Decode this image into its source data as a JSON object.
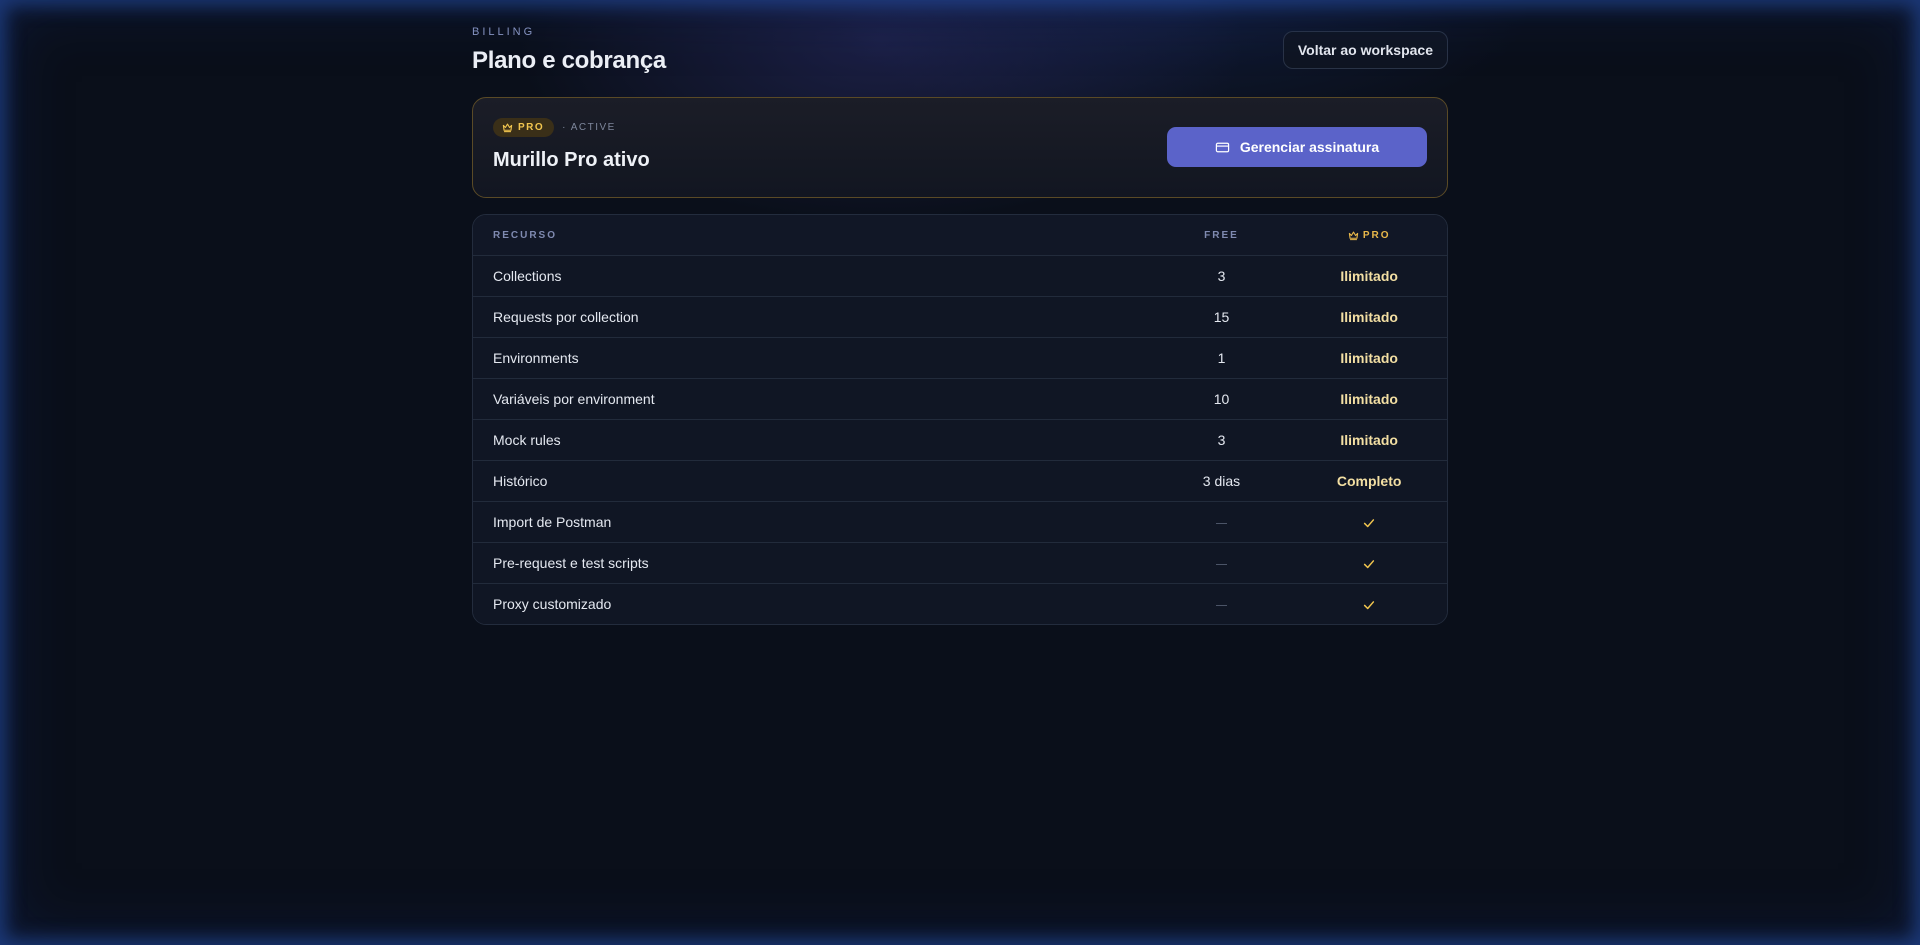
{
  "header": {
    "eyebrow": "BILLING",
    "title": "Plano e cobrança",
    "back_button": "Voltar ao workspace"
  },
  "plan": {
    "badge": "PRO",
    "status": "· ACTIVE",
    "title": "Murillo Pro ativo",
    "manage_button": "Gerenciar assinatura"
  },
  "table": {
    "headers": {
      "feature": "RECURSO",
      "free": "FREE",
      "pro": "PRO"
    },
    "rows": [
      {
        "feature": "Collections",
        "free": "3",
        "pro": "Ilimitado"
      },
      {
        "feature": "Requests por collection",
        "free": "15",
        "pro": "Ilimitado"
      },
      {
        "feature": "Environments",
        "free": "1",
        "pro": "Ilimitado"
      },
      {
        "feature": "Variáveis por environment",
        "free": "10",
        "pro": "Ilimitado"
      },
      {
        "feature": "Mock rules",
        "free": "3",
        "pro": "Ilimitado"
      },
      {
        "feature": "Histórico",
        "free": "3 dias",
        "pro": "Completo"
      },
      {
        "feature": "Import de Postman",
        "free": "—",
        "pro": "✓"
      },
      {
        "feature": "Pre-request e test scripts",
        "free": "—",
        "pro": "✓"
      },
      {
        "feature": "Proxy customizado",
        "free": "—",
        "pro": "✓"
      }
    ]
  },
  "icons": {
    "crown": "crown-icon",
    "card": "credit-card-icon",
    "check": "check-icon",
    "dash": "dash-icon"
  },
  "colors": {
    "accent": "#5b63c9",
    "gold": "#f2c64f",
    "background": "#0a0f1a"
  }
}
